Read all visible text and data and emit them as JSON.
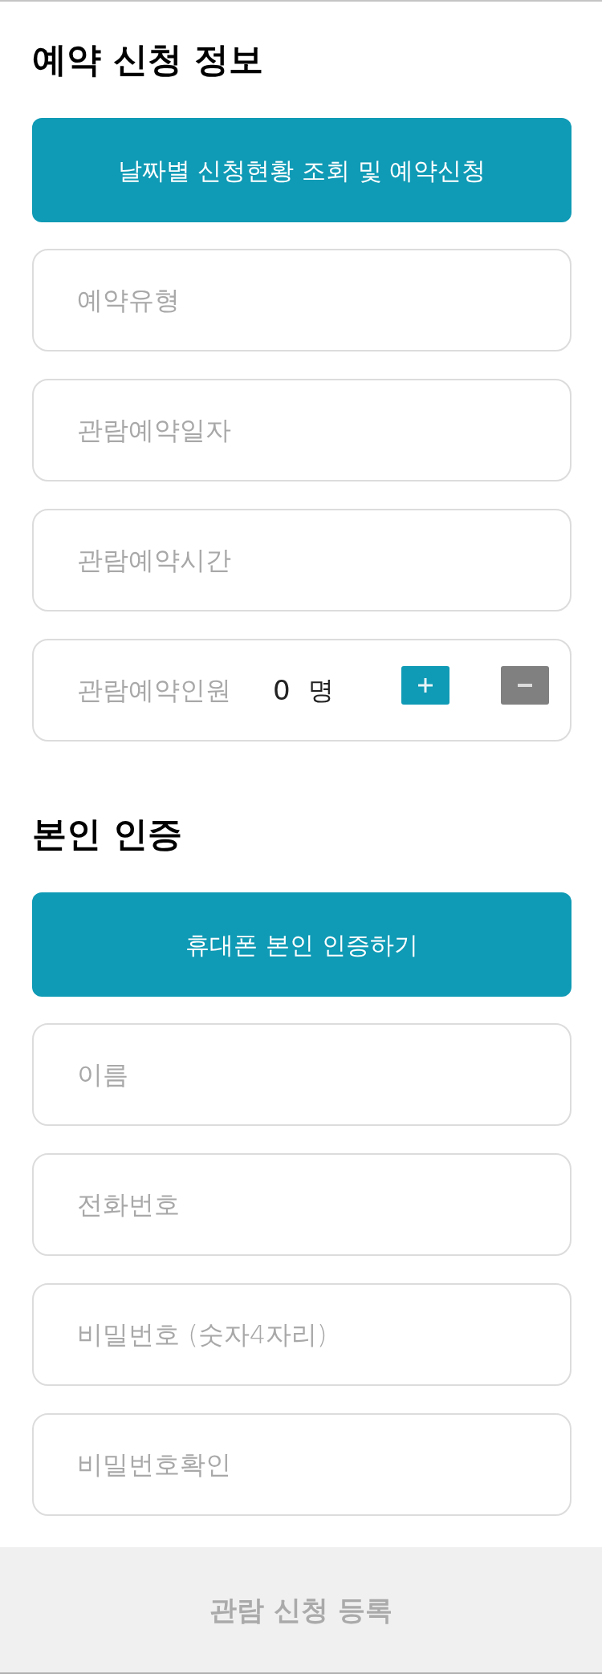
{
  "sections": [
    {
      "title": "예약 신청 정보",
      "button": "날짜별 신청현황 조회 및 예약신청",
      "fields": [
        {
          "kind": "input",
          "placeholder": "예약유형"
        },
        {
          "kind": "input",
          "placeholder": "관람예약일자"
        },
        {
          "kind": "input",
          "placeholder": "관람예약시간"
        },
        {
          "kind": "counter",
          "label": "관람예약인원",
          "value": "0",
          "unit": "명"
        }
      ]
    },
    {
      "title": "본인 인증",
      "button": "휴대폰 본인 인증하기",
      "fields": [
        {
          "kind": "input",
          "placeholder": "이름"
        },
        {
          "kind": "input",
          "placeholder": "전화번호"
        },
        {
          "kind": "input",
          "placeholder": "비밀번호 (숫자4자리)"
        },
        {
          "kind": "input",
          "placeholder": "비밀번호확인"
        }
      ]
    }
  ],
  "submit_button": {
    "label": "관람 신청 등록",
    "disabled": true
  }
}
